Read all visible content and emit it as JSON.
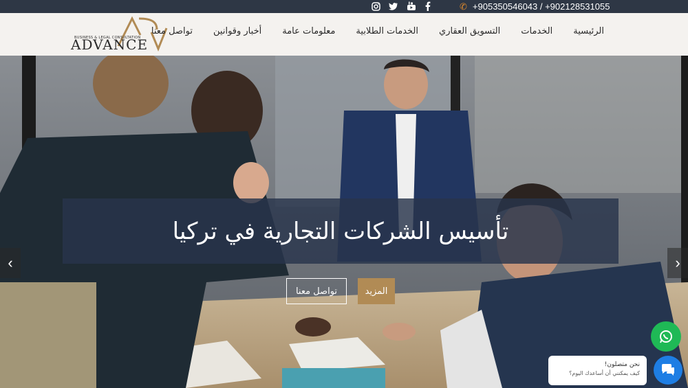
{
  "topbar": {
    "phone": "+905350546043 / +902128531055",
    "social": [
      "instagram-icon",
      "twitter-icon",
      "youtube-icon",
      "facebook-icon"
    ]
  },
  "logo": {
    "name": "ADVANCE",
    "tagline": "BUSINESS & LEGAL CONSULTATION"
  },
  "nav": [
    {
      "label": "الرئيسية"
    },
    {
      "label": "الخدمات"
    },
    {
      "label": "التسويق العقاري"
    },
    {
      "label": "الخدمات الطلابية"
    },
    {
      "label": "معلومات عامة"
    },
    {
      "label": "أخبار وقوانين"
    },
    {
      "label": "تواصل معنا"
    }
  ],
  "hero": {
    "title": "تأسيس الشركات التجارية في تركيا",
    "more_label": "المزيد",
    "contact_label": "تواصل معنا"
  },
  "chat": {
    "line1": "نحن متصلون!",
    "line2": "كيف يمكنني أن أساعدك اليوم؟"
  },
  "colors": {
    "topbar": "#2e3745",
    "accent": "#b18b55",
    "whatsapp": "#1fb956",
    "chat": "#1e7ee4"
  }
}
